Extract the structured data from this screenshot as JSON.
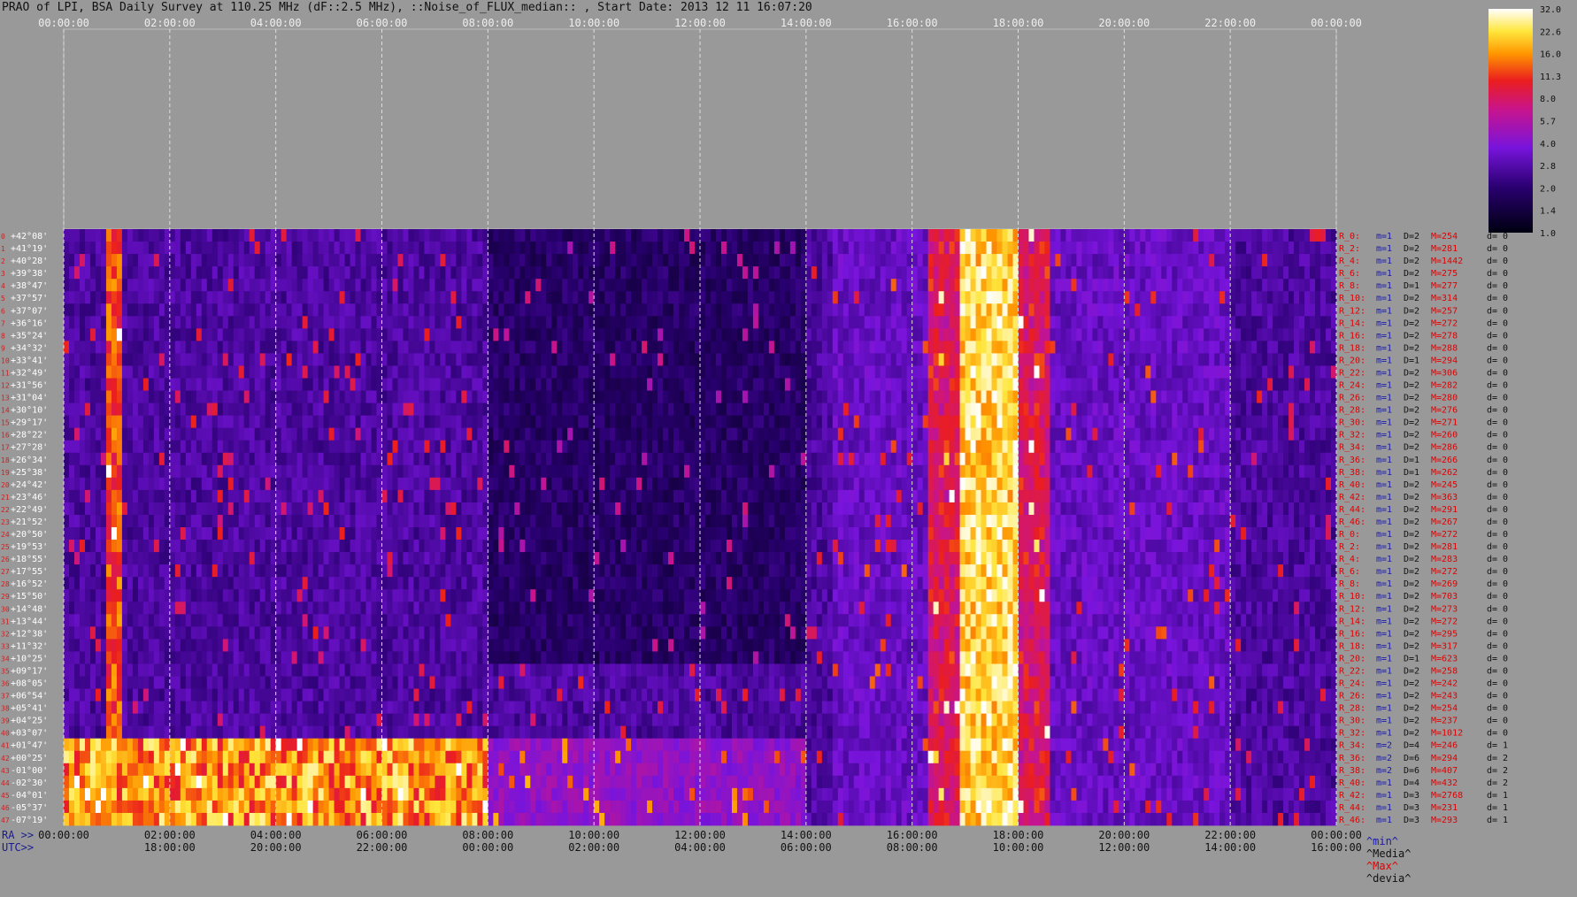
{
  "title": "PRAO of LPI, BSA Daily Survey at 110.25 MHz (dF::2.5 MHz), ::Noise_of_FLUX_median:: , Start Date: 2013 12 11 16:07:20",
  "axis_prefixes": {
    "ra": "RA >>",
    "utc": "UTC>>"
  },
  "stats_legend": {
    "min": "^min^",
    "median": "^Media^",
    "max": "^Max^",
    "devia": "^devia^"
  },
  "chart_data": {
    "type": "heatmap",
    "colormap": "black-purple-red-yellow-white",
    "colors": {
      "background": "#999999",
      "low": "#000010",
      "high": "#ffffff",
      "max_label": "#e00000",
      "min_label": "#1a1aa8"
    },
    "top_time_ticks": [
      "00:00:00",
      "02:00:00",
      "04:00:00",
      "06:00:00",
      "08:00:00",
      "10:00:00",
      "12:00:00",
      "14:00:00",
      "16:00:00",
      "18:00:00",
      "20:00:00",
      "22:00:00",
      "00:00:00"
    ],
    "ra_ticks": [
      "00:00:00",
      "02:00:00",
      "04:00:00",
      "06:00:00",
      "08:00:00",
      "10:00:00",
      "12:00:00",
      "14:00:00",
      "16:00:00",
      "18:00:00",
      "20:00:00",
      "22:00:00",
      "00:00:00"
    ],
    "utc_ticks": [
      "18:00:00",
      "20:00:00",
      "22:00:00",
      "00:00:00",
      "02:00:00",
      "04:00:00",
      "06:00:00",
      "08:00:00",
      "10:00:00",
      "12:00:00",
      "14:00:00",
      "16:00:00"
    ],
    "declinations": [
      "+42°08'",
      "+41°19'",
      "+40°28'",
      "+39°38'",
      "+38°47'",
      "+37°57'",
      "+37°07'",
      "+36°16'",
      "+35°24'",
      "+34°32'",
      "+33°41'",
      "+32°49'",
      "+31°56'",
      "+31°04'",
      "+30°10'",
      "+29°17'",
      "+28°22'",
      "+27°28'",
      "+26°34'",
      "+25°38'",
      "+24°42'",
      "+23°46'",
      "+22°49'",
      "+21°52'",
      "+20°50'",
      "+19°53'",
      "+18°55'",
      "+17°55'",
      "+16°52'",
      "+15°50'",
      "+14°48'",
      "+13°44'",
      "+12°38'",
      "+11°32'",
      "+10°25'",
      "+09°17'",
      "+08°05'",
      "+06°54'",
      "+05°41'",
      "+04°25'",
      "+03°07'",
      "+01°47'",
      "+00°25'",
      "-01°00'",
      "-02°30'",
      "-04°01'",
      "-05°37'",
      "-07°19'"
    ],
    "beam_numbers": [
      "0",
      "1",
      "2",
      "3",
      "4",
      "5",
      "6",
      "7",
      "8",
      "9",
      "10",
      "11",
      "12",
      "13",
      "14",
      "15",
      "16",
      "17",
      "18",
      "19",
      "20",
      "21",
      "22",
      "23",
      "24",
      "25",
      "26",
      "27",
      "28",
      "29",
      "30",
      "31",
      "32",
      "33",
      "34",
      "35",
      "36",
      "37",
      "38",
      "39",
      "40",
      "41",
      "42",
      "43",
      "44",
      "45",
      "46",
      "47"
    ],
    "colorbar": {
      "ticks": [
        "32.0",
        "22.6",
        "16.0",
        "11.3",
        "8.0",
        "5.7",
        "4.0",
        "2.8",
        "2.0",
        "1.4",
        "1.0"
      ]
    },
    "beam_stats": [
      {
        "r": "R_0:",
        "m": "m=1",
        "d": "D=2",
        "M": "M=254",
        "dv": "d= 0"
      },
      {
        "r": "R_2:",
        "m": "m=1",
        "d": "D=2",
        "M": "M=281",
        "dv": "d= 0"
      },
      {
        "r": "R_4:",
        "m": "m=1",
        "d": "D=2",
        "M": "M=1442",
        "dv": "d= 0"
      },
      {
        "r": "R_6:",
        "m": "m=1",
        "d": "D=2",
        "M": "M=275",
        "dv": "d= 0"
      },
      {
        "r": "R_8:",
        "m": "m=1",
        "d": "D=1",
        "M": "M=277",
        "dv": "d= 0"
      },
      {
        "r": "R_10:",
        "m": "m=1",
        "d": "D=2",
        "M": "M=314",
        "dv": "d= 0"
      },
      {
        "r": "R_12:",
        "m": "m=1",
        "d": "D=2",
        "M": "M=257",
        "dv": "d= 0"
      },
      {
        "r": "R_14:",
        "m": "m=1",
        "d": "D=2",
        "M": "M=272",
        "dv": "d= 0"
      },
      {
        "r": "R_16:",
        "m": "m=1",
        "d": "D=2",
        "M": "M=278",
        "dv": "d= 0"
      },
      {
        "r": "R_18:",
        "m": "m=1",
        "d": "D=2",
        "M": "M=288",
        "dv": "d= 0"
      },
      {
        "r": "R_20:",
        "m": "m=1",
        "d": "D=1",
        "M": "M=294",
        "dv": "d= 0"
      },
      {
        "r": "R_22:",
        "m": "m=1",
        "d": "D=2",
        "M": "M=306",
        "dv": "d= 0"
      },
      {
        "r": "R_24:",
        "m": "m=1",
        "d": "D=2",
        "M": "M=282",
        "dv": "d= 0"
      },
      {
        "r": "R_26:",
        "m": "m=1",
        "d": "D=2",
        "M": "M=280",
        "dv": "d= 0"
      },
      {
        "r": "R_28:",
        "m": "m=1",
        "d": "D=2",
        "M": "M=276",
        "dv": "d= 0"
      },
      {
        "r": "R_30:",
        "m": "m=1",
        "d": "D=2",
        "M": "M=271",
        "dv": "d= 0"
      },
      {
        "r": "R_32:",
        "m": "m=1",
        "d": "D=2",
        "M": "M=260",
        "dv": "d= 0"
      },
      {
        "r": "R_34:",
        "m": "m=1",
        "d": "D=2",
        "M": "M=286",
        "dv": "d= 0"
      },
      {
        "r": "R_36:",
        "m": "m=1",
        "d": "D=1",
        "M": "M=266",
        "dv": "d= 0"
      },
      {
        "r": "R_38:",
        "m": "m=1",
        "d": "D=1",
        "M": "M=262",
        "dv": "d= 0"
      },
      {
        "r": "R_40:",
        "m": "m=1",
        "d": "D=2",
        "M": "M=245",
        "dv": "d= 0"
      },
      {
        "r": "R_42:",
        "m": "m=1",
        "d": "D=2",
        "M": "M=363",
        "dv": "d= 0"
      },
      {
        "r": "R_44:",
        "m": "m=1",
        "d": "D=2",
        "M": "M=291",
        "dv": "d= 0"
      },
      {
        "r": "R_46:",
        "m": "m=1",
        "d": "D=2",
        "M": "M=267",
        "dv": "d= 0"
      },
      {
        "r": "R_0:",
        "m": "m=1",
        "d": "D=2",
        "M": "M=272",
        "dv": "d= 0"
      },
      {
        "r": "R_2:",
        "m": "m=1",
        "d": "D=2",
        "M": "M=281",
        "dv": "d= 0"
      },
      {
        "r": "R_4:",
        "m": "m=1",
        "d": "D=2",
        "M": "M=283",
        "dv": "d= 0"
      },
      {
        "r": "R_6:",
        "m": "m=1",
        "d": "D=2",
        "M": "M=272",
        "dv": "d= 0"
      },
      {
        "r": "R_8:",
        "m": "m=1",
        "d": "D=2",
        "M": "M=269",
        "dv": "d= 0"
      },
      {
        "r": "R_10:",
        "m": "m=1",
        "d": "D=2",
        "M": "M=703",
        "dv": "d= 0"
      },
      {
        "r": "R_12:",
        "m": "m=1",
        "d": "D=2",
        "M": "M=273",
        "dv": "d= 0"
      },
      {
        "r": "R_14:",
        "m": "m=1",
        "d": "D=2",
        "M": "M=272",
        "dv": "d= 0"
      },
      {
        "r": "R_16:",
        "m": "m=1",
        "d": "D=2",
        "M": "M=295",
        "dv": "d= 0"
      },
      {
        "r": "R_18:",
        "m": "m=1",
        "d": "D=2",
        "M": "M=317",
        "dv": "d= 0"
      },
      {
        "r": "R_20:",
        "m": "m=1",
        "d": "D=1",
        "M": "M=623",
        "dv": "d= 0"
      },
      {
        "r": "R_22:",
        "m": "m=1",
        "d": "D=2",
        "M": "M=258",
        "dv": "d= 0"
      },
      {
        "r": "R_24:",
        "m": "m=1",
        "d": "D=2",
        "M": "M=242",
        "dv": "d= 0"
      },
      {
        "r": "R_26:",
        "m": "m=1",
        "d": "D=2",
        "M": "M=243",
        "dv": "d= 0"
      },
      {
        "r": "R_28:",
        "m": "m=1",
        "d": "D=2",
        "M": "M=254",
        "dv": "d= 0"
      },
      {
        "r": "R_30:",
        "m": "m=1",
        "d": "D=2",
        "M": "M=237",
        "dv": "d= 0"
      },
      {
        "r": "R_32:",
        "m": "m=1",
        "d": "D=2",
        "M": "M=1012",
        "dv": "d= 0"
      },
      {
        "r": "R_34:",
        "m": "m=2",
        "d": "D=4",
        "M": "M=246",
        "dv": "d= 1"
      },
      {
        "r": "R_36:",
        "m": "m=2",
        "d": "D=6",
        "M": "M=294",
        "dv": "d= 2"
      },
      {
        "r": "R_38:",
        "m": "m=2",
        "d": "D=6",
        "M": "M=407",
        "dv": "d= 2"
      },
      {
        "r": "R_40:",
        "m": "m=1",
        "d": "D=4",
        "M": "M=432",
        "dv": "d= 2"
      },
      {
        "r": "R_42:",
        "m": "m=1",
        "d": "D=3",
        "M": "M=2768",
        "dv": "d= 1"
      },
      {
        "r": "R_44:",
        "m": "m=1",
        "d": "D=3",
        "M": "M=231",
        "dv": "d= 1"
      },
      {
        "r": "R_46:",
        "m": "m=1",
        "d": "D=3",
        "M": "M=293",
        "dv": "d= 1"
      }
    ],
    "features": [
      {
        "name": "sun",
        "ra_hours": [
          16.9,
          18.0
        ],
        "dec_rows": [
          0,
          47
        ],
        "peak": 32
      },
      {
        "name": "strong-source-early",
        "ra_hours": [
          0.8,
          1.1
        ],
        "dec_rows": [
          0,
          47
        ],
        "peak": 16
      },
      {
        "name": "galactic-plane-band",
        "dec_rows": [
          41,
          47
        ],
        "ra_hours": [
          0,
          8
        ],
        "peak": 16
      }
    ]
  }
}
